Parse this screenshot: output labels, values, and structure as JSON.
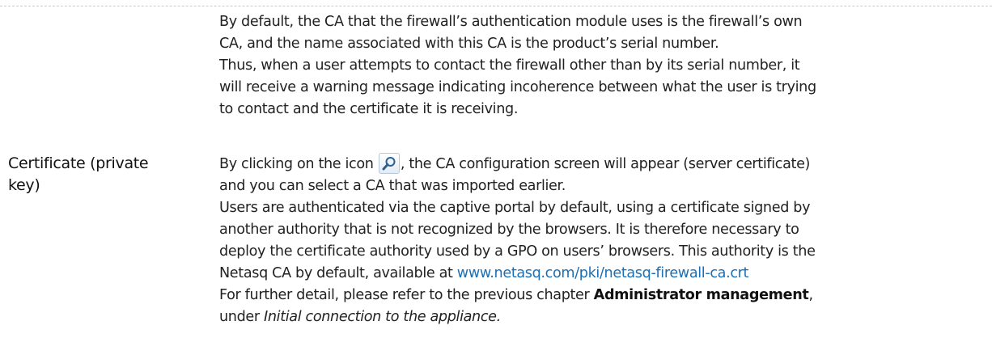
{
  "section1": {
    "lines": [
      "By default, the CA that the firewall’s authentication module uses is the firewall’s own",
      "CA, and the name associated with this CA is the product’s serial number.",
      "Thus, when a user attempts to contact the firewall other than by its serial number, it",
      "will receive a warning message indicating incoherence between what the user is trying",
      "to contact and the certificate it is receiving."
    ]
  },
  "section2": {
    "term_line1": "Certificate (private",
    "term_line2": "key)",
    "icon_before": "By clicking on the icon",
    "icon": "magnifier-icon",
    "icon_after": ", the CA configuration screen will appear (server certificate)",
    "line2": "and you can select a CA that was imported earlier.",
    "line3": "Users are authenticated via the captive portal by default, using a certificate signed by",
    "line4": "another authority that is not recognized by the browsers. It is therefore necessary to",
    "line5": "deploy the certificate authority used by a GPO on users’ browsers. This authority is the",
    "line6_prefix": "Netasq CA by default, available at ",
    "link_text": "www.netasq.com/pki/netasq-firewall-ca.crt",
    "line7_prefix": "For further detail, please refer to the previous chapter ",
    "chapter_bold": "Administrator management",
    "line7_suffix": ",",
    "line8_prefix": "under ",
    "line8_italic": "Initial connection to the appliance."
  },
  "colors": {
    "link": "#1a6fb5",
    "text": "#222222"
  }
}
